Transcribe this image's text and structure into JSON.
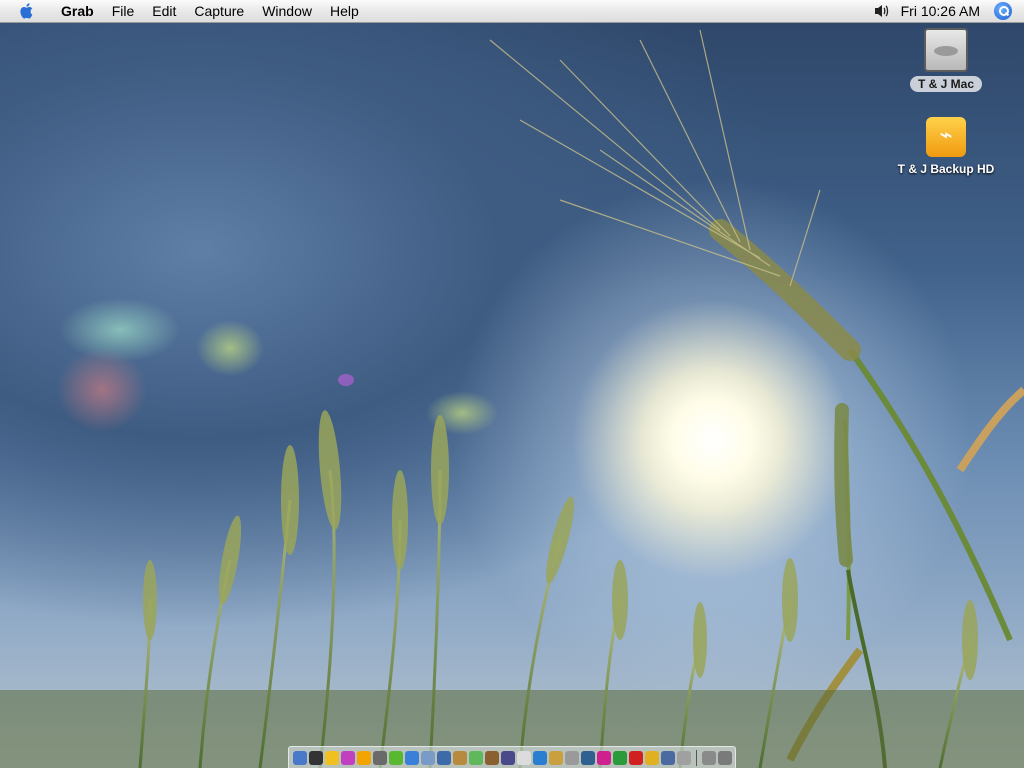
{
  "menubar": {
    "apple_icon": "apple-icon",
    "app_name": "Grab",
    "menus": [
      "File",
      "Edit",
      "Capture",
      "Window",
      "Help"
    ],
    "volume_icon": "volume-icon",
    "clock": "Fri 10:26 AM",
    "spotlight_icon": "spotlight-search-icon"
  },
  "desktop": {
    "icons": [
      {
        "label": "T & J Mac",
        "icon": "hard-drive-icon",
        "selected": true
      },
      {
        "label": "T & J Backup HD",
        "icon": "firewire-drive-icon",
        "selected": false
      }
    ],
    "wallpaper": "wheat-field-sun"
  },
  "dock": {
    "items": [
      {
        "icon": "finder-icon",
        "color": "#4a79c9"
      },
      {
        "icon": "dashboard-icon",
        "color": "#333333"
      },
      {
        "icon": "ichat-icon",
        "color": "#f0c020"
      },
      {
        "icon": "color-picker-icon",
        "color": "#c040c0"
      },
      {
        "icon": "notes-icon",
        "color": "#f2a400"
      },
      {
        "icon": "battery-icon",
        "color": "#6a6a6a"
      },
      {
        "icon": "app-green-icon",
        "color": "#58b830"
      },
      {
        "icon": "network-icon",
        "color": "#3a80d8"
      },
      {
        "icon": "mail-icon",
        "color": "#7a9bc8"
      },
      {
        "icon": "preview-icon",
        "color": "#3d6aa8"
      },
      {
        "icon": "address-book-icon",
        "color": "#b88a40"
      },
      {
        "icon": "itunes-icon",
        "color": "#5fb85a"
      },
      {
        "icon": "iphoto-icon",
        "color": "#8a6030"
      },
      {
        "icon": "imovie-icon",
        "color": "#4a4a8a"
      },
      {
        "icon": "ical-icon",
        "color": "#dcdcdc"
      },
      {
        "icon": "safari-icon",
        "color": "#2a7ed0"
      },
      {
        "icon": "garageband-icon",
        "color": "#c8a040"
      },
      {
        "icon": "system-prefs-icon",
        "color": "#9a9a9a"
      },
      {
        "icon": "quicktime-icon",
        "color": "#306090"
      },
      {
        "icon": "flower-app-icon",
        "color": "#d02090"
      },
      {
        "icon": "music-app-icon",
        "color": "#2a9a3a"
      },
      {
        "icon": "red-app-icon",
        "color": "#d02020"
      },
      {
        "icon": "globe-app-icon",
        "color": "#e0b020"
      },
      {
        "icon": "dvd-icon",
        "color": "#4a6aa0"
      },
      {
        "icon": "utility-icon",
        "color": "#a0a0a0"
      }
    ],
    "right_items": [
      {
        "icon": "downloads-stack-icon",
        "color": "#8a8a8a"
      },
      {
        "icon": "trash-icon",
        "color": "#7a7a7a"
      }
    ]
  }
}
